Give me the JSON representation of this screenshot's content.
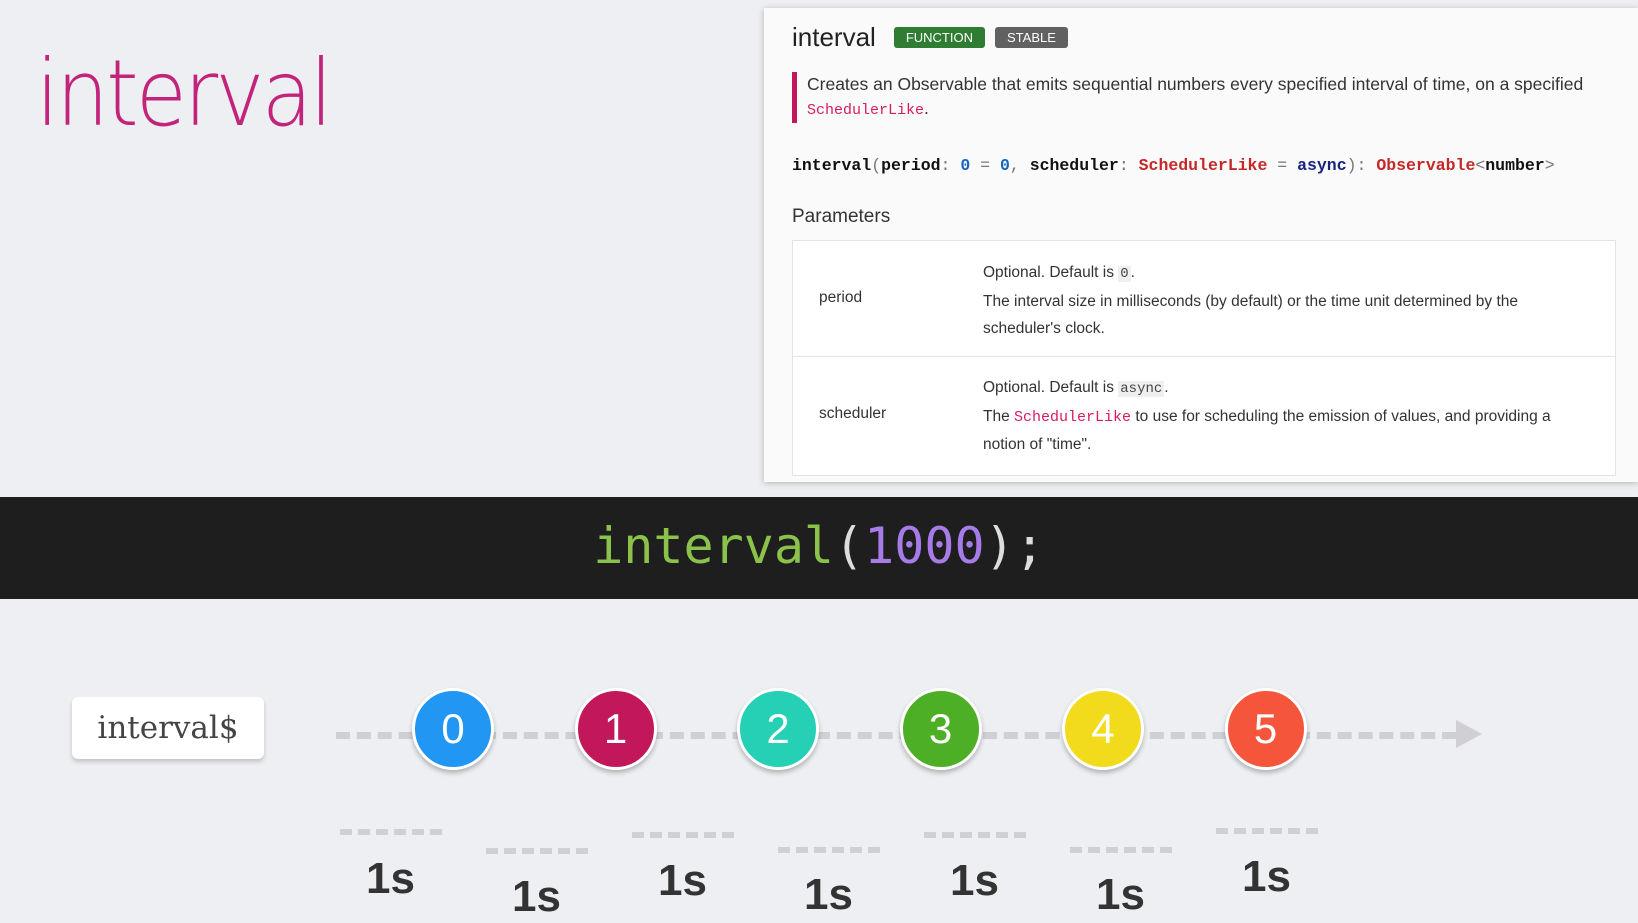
{
  "slide_title": "interval",
  "doc": {
    "name": "interval",
    "badges": {
      "function": "FUNCTION",
      "stable": "STABLE"
    },
    "description_main": "Creates an Observable that emits sequential numbers every specified interval of time, on a specified ",
    "description_code": "SchedulerLike",
    "description_end": ".",
    "signature": {
      "fn": "interval",
      "p1": "period",
      "p1_default": "0",
      "p1_default_value": "0",
      "p2": "scheduler",
      "p2_type": "SchedulerLike",
      "p2_default": "async",
      "return_type": "Observable",
      "return_generic": "number"
    },
    "params_title": "Parameters",
    "params": [
      {
        "name": "period",
        "optional_text": "Optional. Default is ",
        "default_code": "0",
        "desc": "The interval size in milliseconds (by default) or the time unit determined by the scheduler's clock."
      },
      {
        "name": "scheduler",
        "optional_text": "Optional. Default is ",
        "default_code": "async",
        "desc_pre": "The ",
        "desc_code": "SchedulerLike",
        "desc_post": " to use for scheduling the emission of values, and providing a notion of \"time\"."
      }
    ]
  },
  "code_band": {
    "fn": "interval",
    "arg": "1000"
  },
  "marble_diagram": {
    "stream_name": "interval$",
    "marbles": [
      {
        "value": "0",
        "color": "#2196f3"
      },
      {
        "value": "1",
        "color": "#c2185b"
      },
      {
        "value": "2",
        "color": "#26d0b5"
      },
      {
        "value": "3",
        "color": "#4caf26"
      },
      {
        "value": "4",
        "color": "#f2db1c"
      },
      {
        "value": "5",
        "color": "#f4553b"
      }
    ],
    "gap_label": "1s",
    "gaps": [
      "1s",
      "1s",
      "1s",
      "1s",
      "1s",
      "1s",
      "1s"
    ]
  }
}
